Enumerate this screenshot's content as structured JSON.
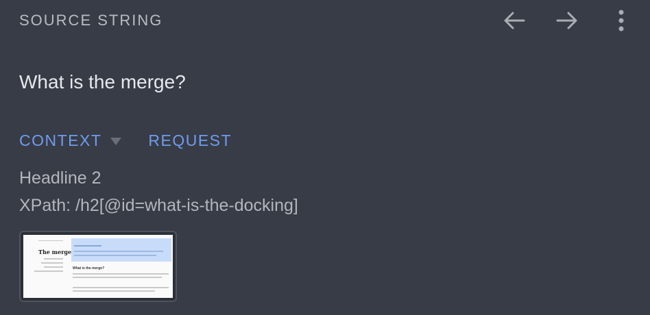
{
  "header": {
    "title": "SOURCE STRING",
    "icons": [
      "arrow-left-icon",
      "arrow-right-icon",
      "more-vertical-icon"
    ]
  },
  "source": {
    "text": "What is the merge?"
  },
  "tabs": [
    {
      "label": "CONTEXT",
      "icon": "caret-down-icon"
    },
    {
      "label": "REQUEST"
    }
  ],
  "context": {
    "type": "Headline 2",
    "xpath": "XPath: /h2[@id=what-is-the-docking]",
    "screenshot": {
      "sidebar_title": "The merge",
      "heading": "What is the merge?"
    }
  },
  "colors": {
    "background": "#383c46",
    "accent": "#6f9cf0",
    "text_primary": "#e6e8ec",
    "text_secondary": "#b3b6bc"
  }
}
